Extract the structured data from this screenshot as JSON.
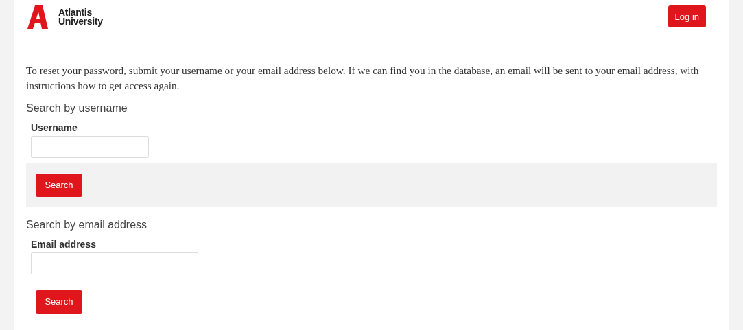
{
  "header": {
    "logo_text": "Atlantis University",
    "login_button": "Log in"
  },
  "intro": "To reset your password, submit your username or your email address below. If we can find you in the database, an email will be sent to your email address, with instructions how to get access again.",
  "sections": [
    {
      "heading": "Search by username",
      "field_label": "Username",
      "button": "Search",
      "kind": "username"
    },
    {
      "heading": "Search by email address",
      "field_label": "Email address",
      "button": "Search",
      "kind": "email"
    }
  ]
}
